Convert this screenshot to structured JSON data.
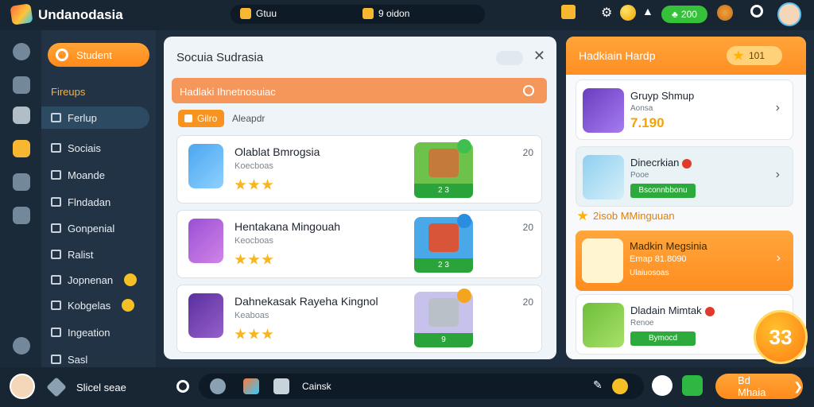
{
  "app": {
    "title": "Undanodasia"
  },
  "topbar": {
    "item1": "Gtuu",
    "item2": "9 oidon",
    "gems": "200"
  },
  "nav": {
    "student_button": "Student",
    "section": "Fireups",
    "items": [
      {
        "label": "Ferlup",
        "active": true
      },
      {
        "label": "Sociais"
      },
      {
        "label": "Moande"
      },
      {
        "label": "Flndadan"
      },
      {
        "label": "Gonpenial"
      },
      {
        "label": "Ralist"
      },
      {
        "label": "Jopnenan"
      },
      {
        "label": "Kobgelas"
      },
      {
        "label": "Ingeation"
      },
      {
        "label": "Sasl"
      }
    ]
  },
  "modal": {
    "title": "Socuia Sudrasia",
    "header": "Hadlaki Ihnetnosuiac",
    "filter_chip": "Gilro",
    "filter_label": "Aleapdr",
    "tasks": [
      {
        "title": "Olablat Bmrogsia",
        "sub": "Koecboas",
        "count": "20",
        "reward": "2 3"
      },
      {
        "title": "Hentakana Mingouah",
        "sub": "Keocboas",
        "count": "20",
        "reward": "2 3"
      },
      {
        "title": "Dahnekasak Rayeha Kingnol",
        "sub": "Keaboas",
        "count": "20",
        "reward": "9"
      }
    ]
  },
  "right_panel": {
    "title": "Hadkiain Hardp",
    "coins": "101",
    "cards": [
      {
        "title": "Gruyp Shmup",
        "sub": "Aonsa",
        "price": "7.190"
      },
      {
        "title": "Dinecrkian",
        "sub": "Pooe",
        "button": "Bsconnbbonu"
      },
      {
        "title": "Madkin Megsinia",
        "sub": "Emap 81.8090",
        "button": "Ulaiuosoas"
      },
      {
        "title": "Dladain Mimtak",
        "sub": "Renoe",
        "button": "Bymocd"
      }
    ],
    "section": "2isob MMinguuan"
  },
  "fab": {
    "label": "33"
  },
  "bottombar": {
    "label": "Slicel seae",
    "pill_text": "Cainsk",
    "more_button": "Bd Mhaia"
  },
  "colors": {
    "accent": "#ff8f23",
    "success": "#2eb843",
    "bg_dark": "#182634"
  }
}
